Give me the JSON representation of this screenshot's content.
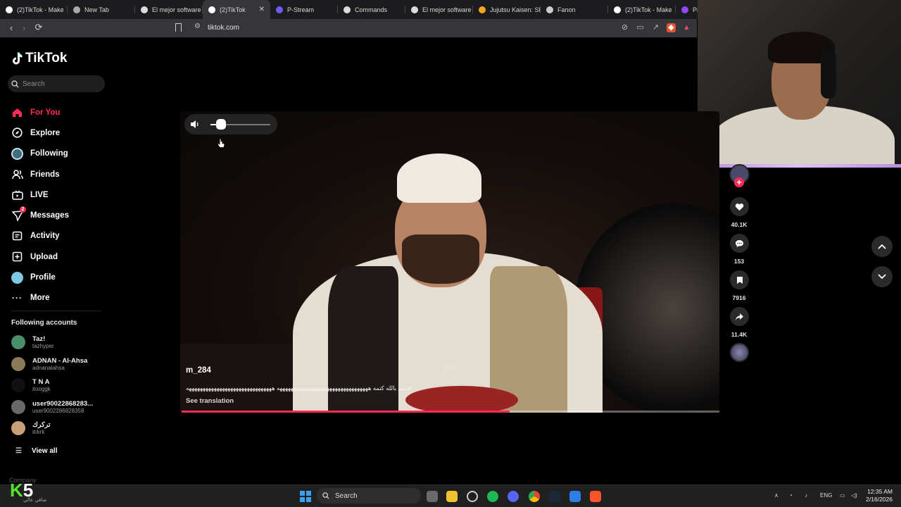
{
  "browser": {
    "tabs": [
      {
        "label": "(2)TikTok - Make",
        "icon": "tiktok-icon",
        "color": "#ffffff"
      },
      {
        "label": "New Tab",
        "icon": "brave-icon",
        "color": "#aaaaaa"
      },
      {
        "label": "El mejor software",
        "icon": "diamond-icon",
        "color": "#dddddd"
      },
      {
        "label": "(2)TikTok",
        "icon": "tiktok-icon",
        "color": "#ffffff",
        "active": true
      },
      {
        "label": "P-Stream",
        "icon": "pstream-icon",
        "color": "#6b5cf0"
      },
      {
        "label": "Commands",
        "icon": "discord-icon",
        "color": "#dddddd"
      },
      {
        "label": "El mejor software",
        "icon": "diamond-icon",
        "color": "#dddddd"
      },
      {
        "label": "Jujutsu Kaisen: Sh",
        "icon": "fandom-icon",
        "color": "#f5a623"
      },
      {
        "label": "Fanon",
        "icon": "globe-icon",
        "color": "#cccccc"
      },
      {
        "label": "(2)TikTok - Make",
        "icon": "tiktok-icon",
        "color": "#ffffff"
      },
      {
        "label": "Payo",
        "icon": "twitch-icon",
        "color": "#9146ff"
      }
    ],
    "url": "tiktok.com"
  },
  "sidebar": {
    "logo_text": "TikTok",
    "search_placeholder": "Search",
    "nav": [
      {
        "label": "For You",
        "icon": "home-icon",
        "active": true
      },
      {
        "label": "Explore",
        "icon": "compass-icon"
      },
      {
        "label": "Following",
        "icon": "following-avatar-icon"
      },
      {
        "label": "Friends",
        "icon": "friends-icon"
      },
      {
        "label": "LIVE",
        "icon": "live-icon"
      },
      {
        "label": "Messages",
        "icon": "messages-icon",
        "badge": "2"
      },
      {
        "label": "Activity",
        "icon": "activity-icon"
      },
      {
        "label": "Upload",
        "icon": "upload-icon"
      },
      {
        "label": "Profile",
        "icon": "profile-icon"
      },
      {
        "label": "More",
        "icon": "more-icon"
      }
    ],
    "following_title": "Following accounts",
    "accounts": [
      {
        "name": "Taz!",
        "username": "tazhyper",
        "color": "#4a8f6a"
      },
      {
        "name": "ADNAN - Al-Ahsa",
        "username": "adnanalahsa",
        "color": "#8a7a5a"
      },
      {
        "name": "T N A",
        "username": "itooggk",
        "color": "#111111"
      },
      {
        "name": "user90022868283...",
        "username": "user9002286828358",
        "color": "#6a6a6a"
      },
      {
        "name": "ترکرك",
        "username": "itrkrk",
        "color": "#c9a07a"
      }
    ],
    "view_all": "View all",
    "company": "Company"
  },
  "video": {
    "username": "m_284",
    "caption": "اقسم بالله كتمه هههههههههههههههههههههههههههههههههه هههههههههههههههههههههههههههههههه",
    "see_translation": "See translation",
    "watermark": "RH",
    "progress": 0.61,
    "volume": 0.18
  },
  "actions": {
    "likes": "40.1K",
    "comments": "153",
    "saves": "7916",
    "shares": "11.4K"
  },
  "taskbar": {
    "search_placeholder": "Search",
    "badge_logo": "5",
    "badge_sub": "صافي عالي",
    "lang": "ENG",
    "time": "12:35 AM",
    "date": "2/16/2026"
  }
}
